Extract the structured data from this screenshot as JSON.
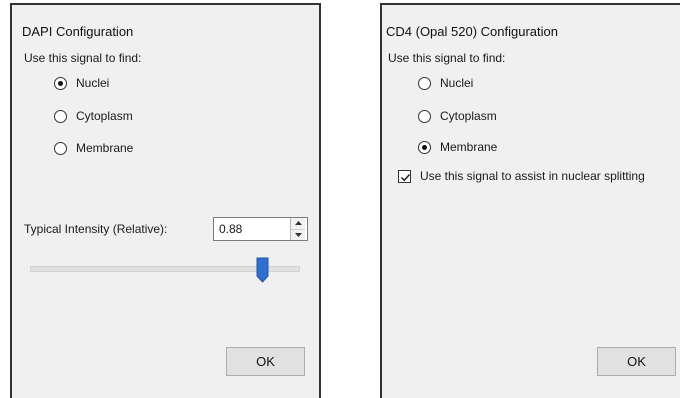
{
  "dialogs": {
    "dapi": {
      "title": "DAPI Configuration",
      "prompt": "Use this signal to find:",
      "options": [
        "Nuclei",
        "Cytoplasm",
        "Membrane"
      ],
      "selected": "Nuclei",
      "intensity_label": "Typical Intensity (Relative):",
      "intensity_value": "0.88",
      "slider_level": 0.86,
      "ok_label": "OK"
    },
    "cd4": {
      "title": "CD4 (Opal 520) Configuration",
      "prompt": "Use this signal to find:",
      "options": [
        "Nuclei",
        "Cytoplasm",
        "Membrane"
      ],
      "selected": "Membrane",
      "assist_label": "Use this signal to assist in nuclear splitting",
      "assist_checked": true,
      "ok_label": "OK"
    }
  },
  "colors": {
    "accent": "#2f6fd1",
    "dialog_bg": "#f0f0f0"
  },
  "icons": {
    "spin_up": "spin-up-arrow-icon",
    "spin_down": "spin-down-arrow-icon",
    "check": "checkmark-icon"
  }
}
